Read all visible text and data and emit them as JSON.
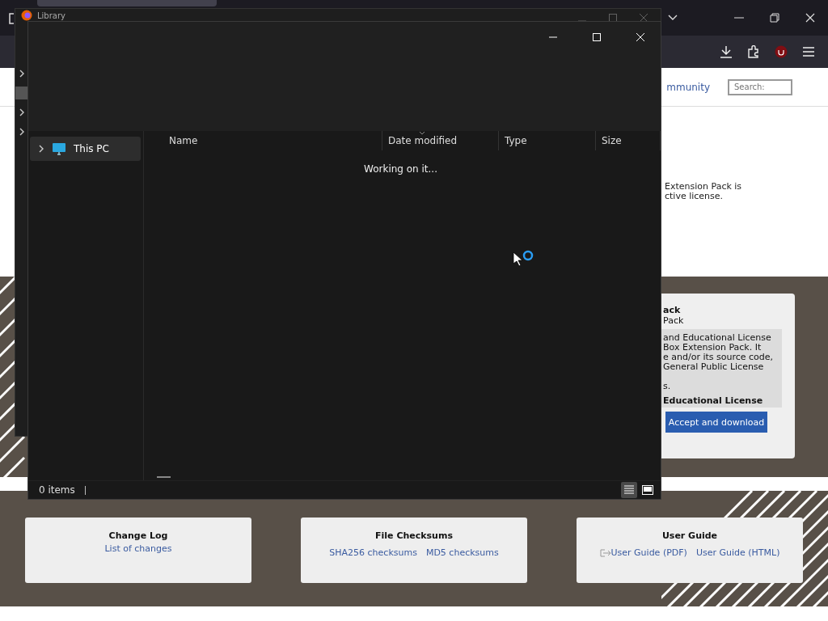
{
  "browser": {
    "page": {
      "nav_link": "mmunity",
      "search": {
        "placeholder": "Search:"
      },
      "notice_lines": [
        "Extension Pack is",
        "ctive license."
      ],
      "license_card": {
        "title": "ack",
        "subtitle": "Pack",
        "license_lines": [
          "and Educational License",
          "Box Extension Pack. It",
          "e and/or its source code,",
          "General Public License"
        ],
        "license_note": "s.",
        "license_name": "Educational License",
        "button": "Accept and download"
      },
      "footer_cards": [
        {
          "title": "Change Log",
          "links": [
            {
              "label": "List of changes",
              "icon": false
            }
          ]
        },
        {
          "title": "File Checksums",
          "links": [
            {
              "label": "SHA256 checksums",
              "icon": false
            },
            {
              "label": "MD5 checksums",
              "icon": false
            }
          ]
        },
        {
          "title": "User Guide",
          "links": [
            {
              "label": "User Guide (PDF)",
              "icon": true
            },
            {
              "label": "User Guide (HTML)",
              "icon": false
            }
          ]
        }
      ]
    }
  },
  "library_window": {
    "title": "Library",
    "sidebar_items": [
      {
        "selected": false
      },
      {
        "selected": true
      },
      {
        "selected": false
      },
      {
        "selected": false
      }
    ]
  },
  "file_dialog": {
    "nav_items": [
      {
        "label": "This PC",
        "selected": true
      }
    ],
    "columns": [
      "Name",
      "Date modified",
      "Type",
      "Size"
    ],
    "message": "Working on it...",
    "status": "0 items",
    "views": [
      {
        "kind": "details",
        "selected": true
      },
      {
        "kind": "tiles",
        "selected": false
      }
    ]
  }
}
